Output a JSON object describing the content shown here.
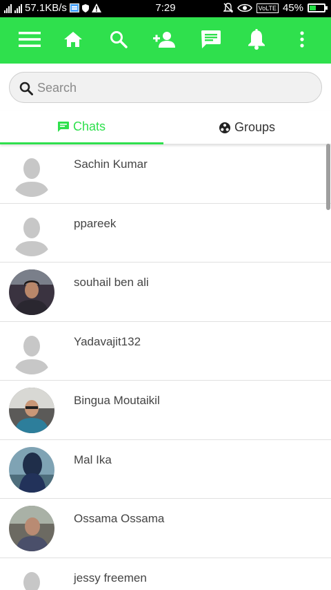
{
  "status_bar": {
    "network_speed": "57.1KB/s",
    "time": "7:29",
    "volte": "VoLTE",
    "battery": "45%",
    "battery_level": 0.45,
    "icons": [
      "signal-icon",
      "data-icon",
      "shield-icon",
      "alert-icon",
      "mute-icon",
      "eye-icon"
    ]
  },
  "toolbar": {
    "color": "#2fe04d",
    "buttons": [
      "menu-icon",
      "home-icon",
      "search-icon",
      "add-user-icon",
      "chat-icon",
      "notification-icon",
      "more-vert-icon"
    ]
  },
  "search": {
    "placeholder": "Search"
  },
  "tabs": [
    {
      "label": "Chats",
      "active": true,
      "icon": "message-icon"
    },
    {
      "label": "Groups",
      "active": false,
      "icon": "groups-icon"
    }
  ],
  "chats": [
    {
      "name": "Sachin Kumar",
      "avatar": "placeholder"
    },
    {
      "name": "ppareek",
      "avatar": "placeholder"
    },
    {
      "name": "souhail ben ali",
      "avatar": "photo"
    },
    {
      "name": "Yadavajit132",
      "avatar": "placeholder"
    },
    {
      "name": "Bingua Moutaikil",
      "avatar": "photo"
    },
    {
      "name": "Mal Ika",
      "avatar": "photo"
    },
    {
      "name": "Ossama Ossama",
      "avatar": "photo"
    },
    {
      "name": "jessy freemen",
      "avatar": "placeholder"
    }
  ]
}
